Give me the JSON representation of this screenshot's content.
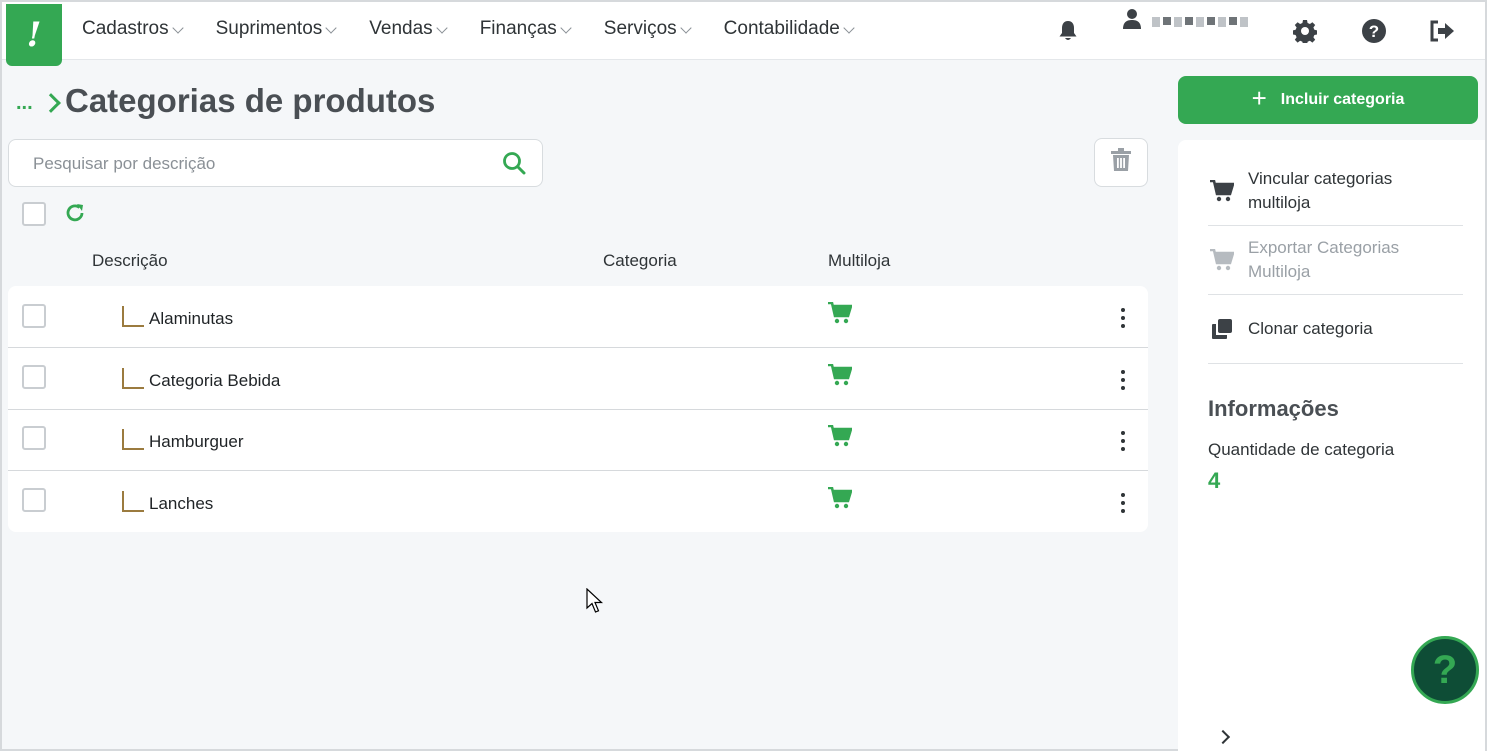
{
  "nav": {
    "logo": "!",
    "menus": [
      {
        "label": "Cadastros"
      },
      {
        "label": "Suprimentos"
      },
      {
        "label": "Vendas"
      },
      {
        "label": "Finanças"
      },
      {
        "label": "Serviços"
      },
      {
        "label": "Contabilidade"
      }
    ],
    "icons": [
      "bell-icon",
      "user-icon",
      "gear-icon",
      "help-circle-icon",
      "logout-icon"
    ]
  },
  "breadcrumb": {
    "ellipsis": "..."
  },
  "page": {
    "title": "Categorias de produtos"
  },
  "search": {
    "placeholder": "Pesquisar por descrição",
    "value": ""
  },
  "table": {
    "columns": {
      "descricao": "Descrição",
      "categoria": "Categoria",
      "multiloja": "Multiloja"
    },
    "rows": [
      {
        "descricao": "Alaminutas",
        "categoria": "",
        "multiloja": true
      },
      {
        "descricao": "Categoria Bebida",
        "categoria": "",
        "multiloja": true
      },
      {
        "descricao": "Hamburguer",
        "categoria": "",
        "multiloja": true
      },
      {
        "descricao": "Lanches",
        "categoria": "",
        "multiloja": true
      }
    ]
  },
  "sidebar": {
    "add_button": {
      "plus": "+",
      "label": "Incluir categoria"
    },
    "actions": [
      {
        "label": "Vincular categorias multiloja",
        "icon": "cart-icon",
        "enabled": true
      },
      {
        "label": "Exportar Categorias Multiloja",
        "icon": "cart-icon",
        "enabled": false
      },
      {
        "label": "Clonar categoria",
        "icon": "clone-icon",
        "enabled": true
      }
    ],
    "info": {
      "title": "Informações",
      "count_label": "Quantidade de categoria",
      "count_value": "4"
    }
  },
  "help_fab": {
    "label": "?"
  },
  "colors": {
    "accent": "#34a853",
    "fab_bg": "#0e4d36",
    "tree_line": "#9b7b3f"
  }
}
